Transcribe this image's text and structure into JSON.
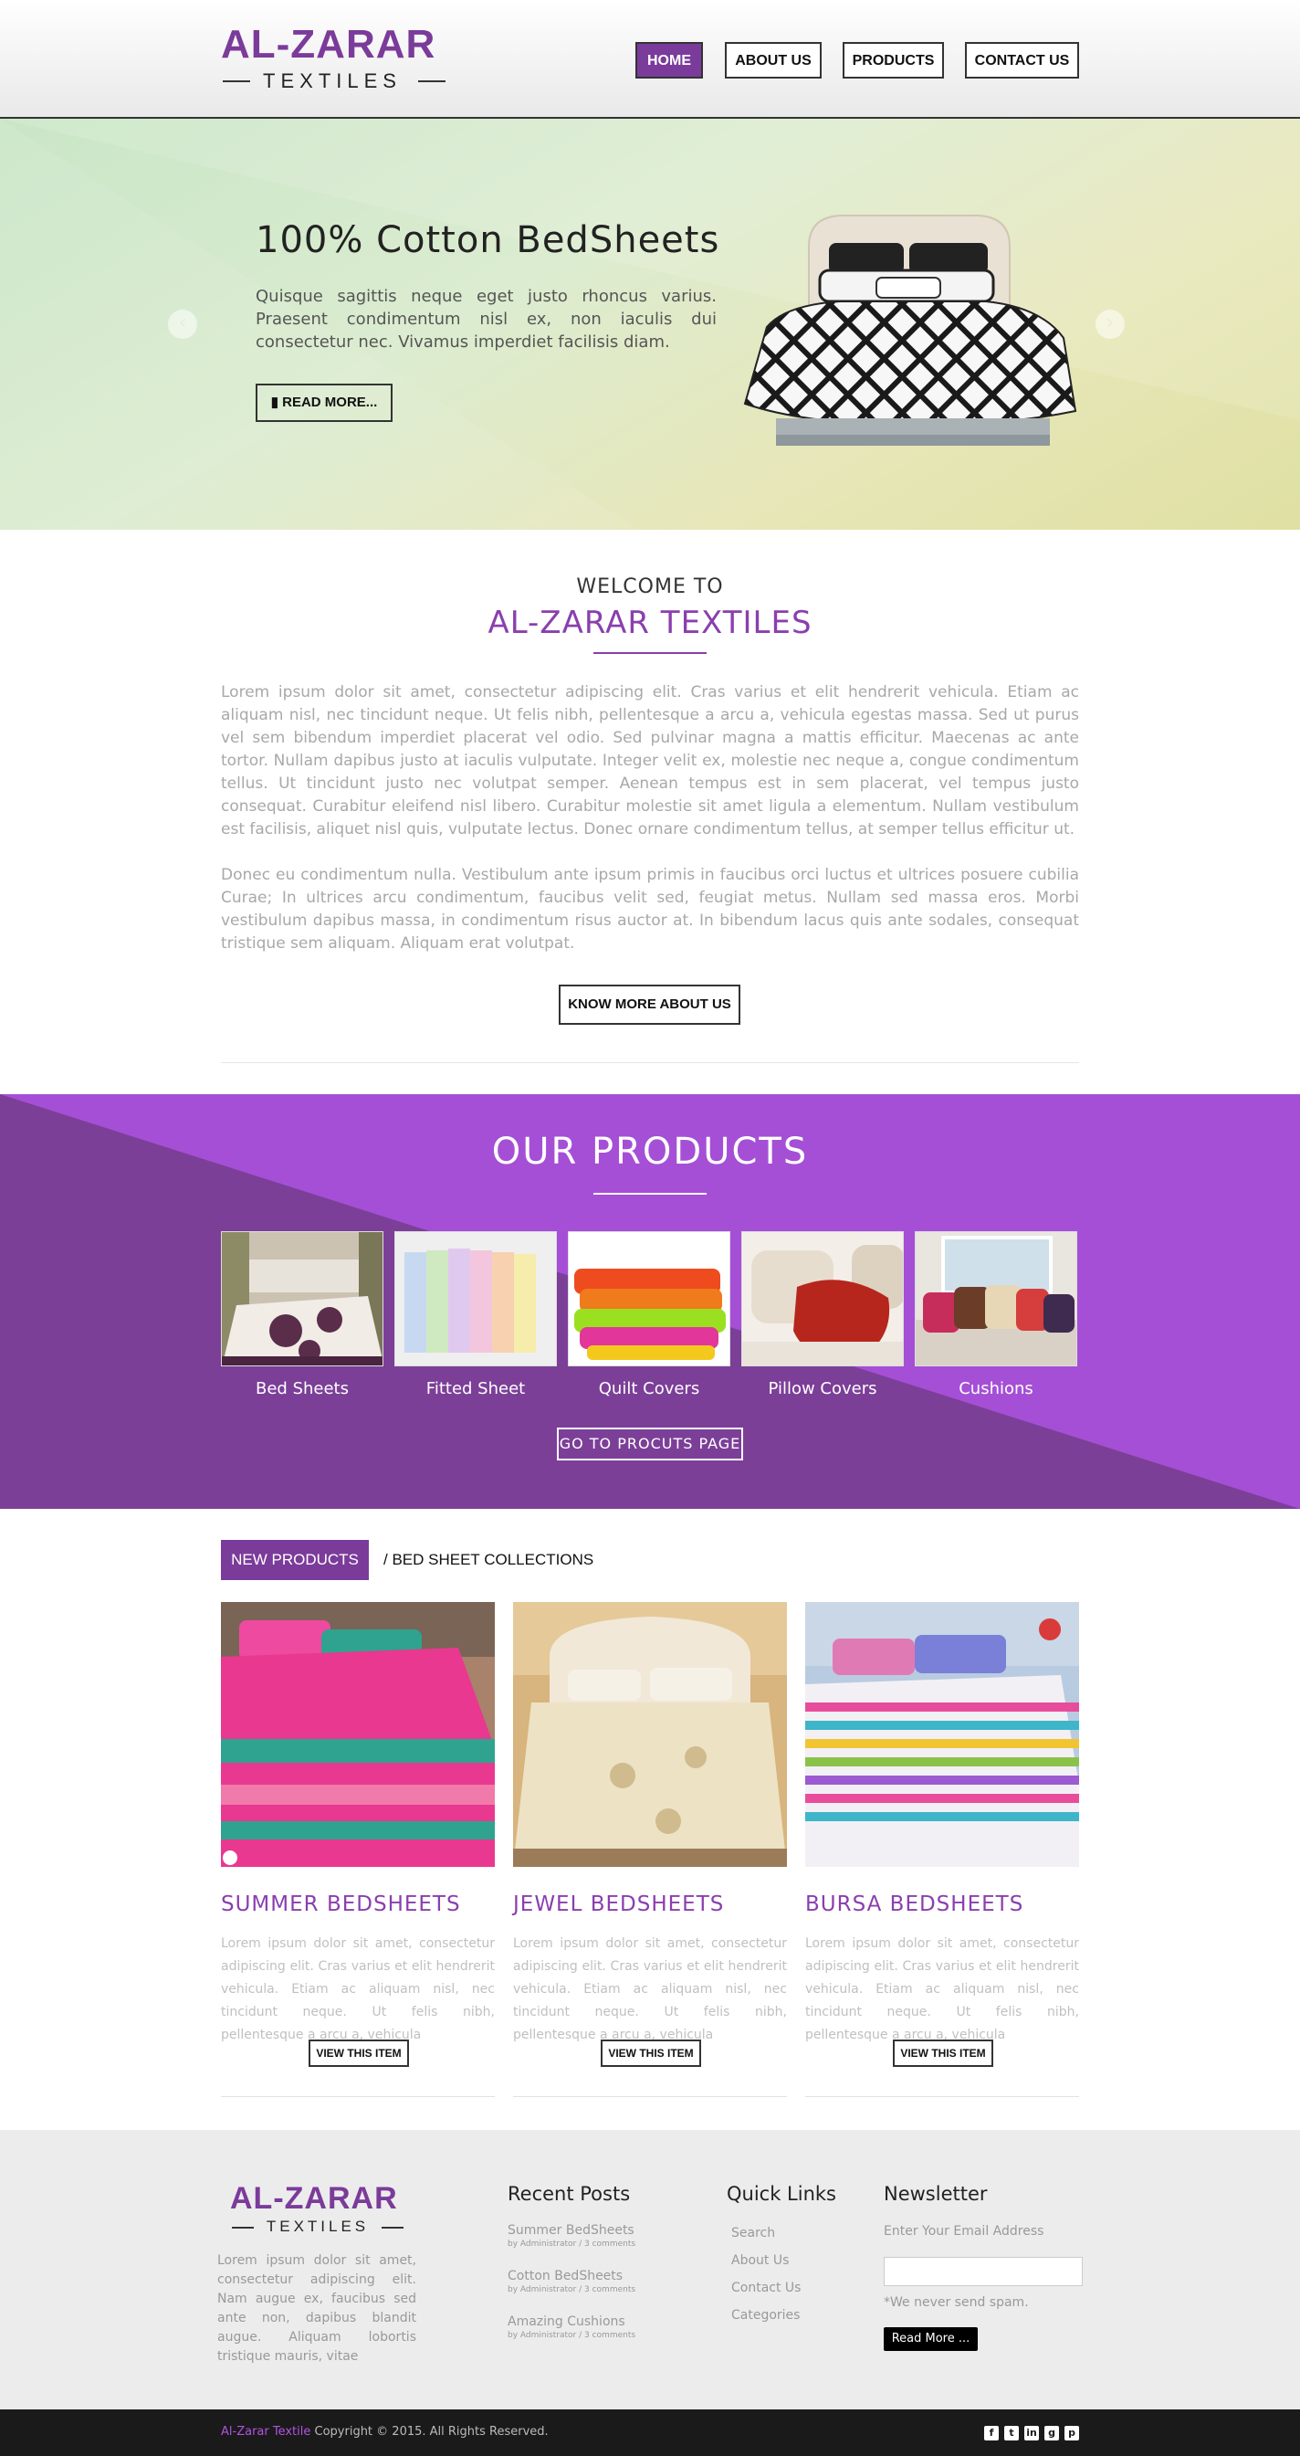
{
  "header": {
    "logo_main": "AL-ZARAR",
    "logo_sub": "TEXTILES",
    "nav": [
      "HOME",
      "ABOUT US",
      "PRODUCTS",
      "CONTACT US"
    ]
  },
  "hero": {
    "title": "100% Cotton BedSheets",
    "text": "Quisque sagittis neque eget justo rhoncus varius. Praesent condimentum nisl ex, non iaculis dui consectetur nec. Vivamus imperdiet facilisis diam.",
    "button": "READ MORE..."
  },
  "welcome": {
    "small": "WELCOME TO",
    "big": "AL-ZARAR TEXTILES",
    "para1": "Lorem ipsum dolor sit amet, consectetur adipiscing elit. Cras varius et elit hendrerit vehicula. Etiam ac aliquam nisl, nec tincidunt neque. Ut felis nibh, pellentesque a arcu a, vehicula egestas massa. Sed ut purus vel sem bibendum imperdiet placerat vel odio. Sed pulvinar magna a mattis efficitur. Maecenas ac ante tortor. Nullam dapibus justo at iaculis vulputate. Integer velit ex, molestie nec neque a, congue condimentum tellus. Ut tincidunt justo nec volutpat semper. Aenean tempus est in sem placerat, vel tempus justo consequat. Curabitur eleifend nisl libero. Curabitur molestie sit amet ligula a elementum. Nullam vestibulum est facilisis, aliquet nisl quis, vulputate lectus. Donec ornare condimentum tellus, at semper tellus efficitur ut.",
    "para2": "Donec eu condimentum nulla. Vestibulum ante ipsum primis in faucibus orci luctus et ultrices posuere cubilia Curae; In ultrices arcu condimentum, faucibus velit sed, feugiat metus. Nullam sed massa eros. Morbi vestibulum dapibus massa, in condimentum risus auctor at. In bibendum lacus quis ante sodales, consequat tristique sem aliquam. Aliquam erat volutpat.",
    "button": "KNOW MORE ABOUT US"
  },
  "products": {
    "title": "OUR PRODUCTS",
    "items": [
      "Bed Sheets",
      "Fitted Sheet",
      "Quilt Covers",
      "Pillow Covers",
      "Cushions"
    ],
    "button": "GO TO PROCUTS PAGE"
  },
  "new_products": {
    "tab_active": "NEW PRODUCTS",
    "tab_other": "/ BED SHEET COLLECTIONS",
    "cards": [
      {
        "title": "SUMMER BEDSHEETS",
        "text": "Lorem ipsum dolor sit amet, consectetur adipiscing elit. Cras varius et elit hendrerit vehicula. Etiam ac aliquam nisl, nec tincidunt neque. Ut felis nibh, pellentesque a arcu a, vehicula",
        "button": "VIEW THIS ITEM"
      },
      {
        "title": "JEWEL BEDSHEETS",
        "text": "Lorem ipsum dolor sit amet, consectetur adipiscing elit. Cras varius et elit hendrerit vehicula. Etiam ac aliquam nisl, nec tincidunt neque. Ut felis nibh, pellentesque a arcu a, vehicula",
        "button": "VIEW THIS ITEM"
      },
      {
        "title": "BURSA BEDSHEETS",
        "text": "Lorem ipsum dolor sit amet, consectetur adipiscing elit. Cras varius et elit hendrerit vehicula. Etiam ac aliquam nisl, nec tincidunt neque. Ut felis nibh, pellentesque a arcu a, vehicula",
        "button": "VIEW THIS ITEM"
      }
    ]
  },
  "footer": {
    "logo_main": "AL-ZARAR",
    "logo_sub": "TEXTILES",
    "about": "Lorem ipsum dolor sit amet, consectetur adipiscing elit. Nam augue ex, faucibus sed ante non, dapibus blandit augue. Aliquam lobortis tristique mauris, vitae",
    "recent_title": "Recent Posts",
    "posts": [
      {
        "title": "Summer BedSheets",
        "meta": "by Administrator / 3 comments"
      },
      {
        "title": "Cotton BedSheets",
        "meta": "by Administrator / 3 comments"
      },
      {
        "title": "Amazing Cushions",
        "meta": "by Administrator / 3 comments"
      }
    ],
    "quick_title": "Quick Links",
    "links": [
      "Search",
      "About Us",
      "Contact Us",
      "Categories"
    ],
    "newsletter_title": "Newsletter",
    "newsletter_label": "Enter Your Email Address",
    "newsletter_note": "*We never send spam.",
    "newsletter_button": "Read More ..."
  },
  "bottom": {
    "brand": "Al-Zarar Textile",
    "copyright": " Copyright © 2015. All Rights Reserved.",
    "social_icons": [
      "facebook-icon",
      "twitter-icon",
      "linkedin-icon",
      "googleplus-icon",
      "pinterest-icon"
    ]
  },
  "colors": {
    "brand_purple": "#7b3b9a",
    "band_purple": "#a54fd6",
    "band_dark": "#7c3f98"
  }
}
